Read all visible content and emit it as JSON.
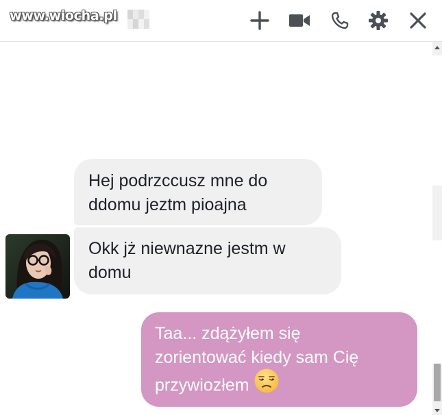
{
  "watermark": {
    "text": "www.wiocha.pl"
  },
  "toolbar": {
    "icons": [
      "add-icon",
      "video-call-icon",
      "phone-icon",
      "gear-icon",
      "close-icon"
    ],
    "icon_color": "#90949c"
  },
  "conversation": {
    "messages": [
      {
        "direction": "incoming",
        "lines": [
          "Hej podrzccusz mne do",
          "ddomu jeztm pioajna"
        ]
      },
      {
        "direction": "incoming",
        "lines": [
          "Okk jż niewnazne jestm w",
          "domu"
        ]
      },
      {
        "direction": "outgoing",
        "lines": [
          "Taa... zdążyłem się",
          "zorientować kiedy sam Cię",
          "przywiozłem"
        ],
        "emoji": "unamused-face-emoji"
      }
    ]
  },
  "colors": {
    "incoming_bubble": "#f1f0f0",
    "outgoing_bubble": "#d496c2",
    "incoming_text": "#1d2129",
    "outgoing_text": "#ffffff"
  }
}
